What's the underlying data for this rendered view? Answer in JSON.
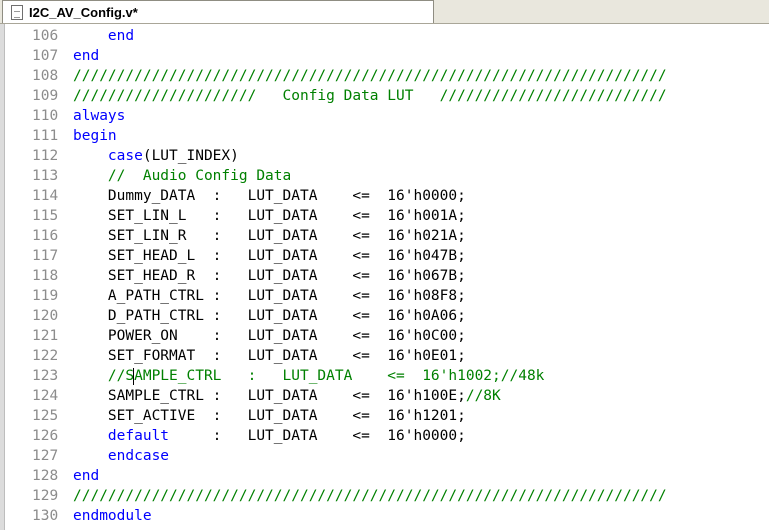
{
  "tab": {
    "title": "I2C_AV_Config.v*"
  },
  "colors": {
    "keyword": "#0000ff",
    "comment": "#008000",
    "text": "#000000",
    "line_number": "#8c8c8c"
  },
  "lines": [
    {
      "n": "106",
      "code": "    end",
      "type": "kw"
    },
    {
      "n": "107",
      "code": "end",
      "type": "kw"
    },
    {
      "n": "108",
      "code": "////////////////////////////////////////////////////////////////////",
      "type": "cm"
    },
    {
      "n": "109",
      "code": "/////////////////////   Config Data LUT   //////////////////////////",
      "type": "cm"
    },
    {
      "n": "110",
      "code": "always",
      "type": "kw"
    },
    {
      "n": "111",
      "code": "begin",
      "type": "kw"
    },
    {
      "n": "112",
      "code": "    case",
      "type": "kw",
      "rest": "(LUT_INDEX)"
    },
    {
      "n": "113",
      "code": "    //  Audio Config Data",
      "type": "cm"
    },
    {
      "n": "114",
      "code": "    Dummy_DATA  :   LUT_DATA    <=  16'h0000;",
      "type": "tx"
    },
    {
      "n": "115",
      "code": "    SET_LIN_L   :   LUT_DATA    <=  16'h001A;",
      "type": "tx"
    },
    {
      "n": "116",
      "code": "    SET_LIN_R   :   LUT_DATA    <=  16'h021A;",
      "type": "tx"
    },
    {
      "n": "117",
      "code": "    SET_HEAD_L  :   LUT_DATA    <=  16'h047B;",
      "type": "tx"
    },
    {
      "n": "118",
      "code": "    SET_HEAD_R  :   LUT_DATA    <=  16'h067B;",
      "type": "tx"
    },
    {
      "n": "119",
      "code": "    A_PATH_CTRL :   LUT_DATA    <=  16'h08F8;",
      "type": "tx"
    },
    {
      "n": "120",
      "code": "    D_PATH_CTRL :   LUT_DATA    <=  16'h0A06;",
      "type": "tx"
    },
    {
      "n": "121",
      "code": "    POWER_ON    :   LUT_DATA    <=  16'h0C00;",
      "type": "tx"
    },
    {
      "n": "122",
      "code": "    SET_FORMAT  :   LUT_DATA    <=  16'h0E01;",
      "type": "tx"
    },
    {
      "n": "123",
      "code": "    //SAMPLE_CTRL   :   LUT_DATA    <=  16'h1002;//48k",
      "type": "cm"
    },
    {
      "n": "124",
      "code": "    SAMPLE_CTRL :   LUT_DATA    <=  16'h100E;",
      "type": "tx",
      "comment": "//8K"
    },
    {
      "n": "125",
      "code": "    SET_ACTIVE  :   LUT_DATA    <=  16'h1201;",
      "type": "tx"
    },
    {
      "n": "126",
      "code": "    default",
      "type": "kw",
      "rest": "     :   LUT_DATA    <=  16'h0000;"
    },
    {
      "n": "127",
      "code": "    endcase",
      "type": "kw"
    },
    {
      "n": "128",
      "code": "end",
      "type": "kw"
    },
    {
      "n": "129",
      "code": "////////////////////////////////////////////////////////////////////",
      "type": "cm"
    },
    {
      "n": "130",
      "code": "endmodule",
      "type": "kw"
    }
  ]
}
